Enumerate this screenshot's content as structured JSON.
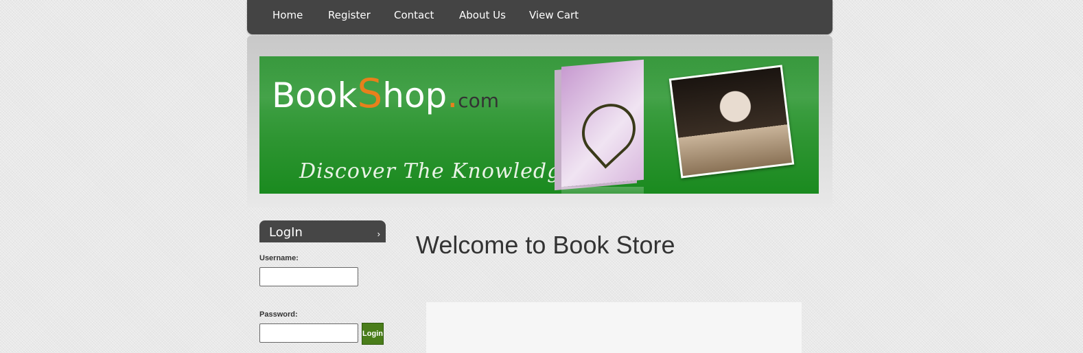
{
  "nav": {
    "items": [
      {
        "label": "Home"
      },
      {
        "label": "Register"
      },
      {
        "label": "Contact"
      },
      {
        "label": "About Us"
      },
      {
        "label": "View Cart"
      }
    ]
  },
  "banner": {
    "logo_part1": "Book",
    "logo_s": "S",
    "logo_part2": "hop",
    "logo_dot": ".",
    "logo_tld": "com",
    "tagline": "Discover The Knowledge"
  },
  "login": {
    "title": "LogIn",
    "chevron": "›",
    "username_label": "Username:",
    "username_value": "",
    "password_label": "Password:",
    "password_value": "",
    "button_label": "Login"
  },
  "main": {
    "heading": "Welcome to Book Store"
  },
  "colors": {
    "nav_bg": "#444444",
    "banner_green": "#2e9532",
    "logo_accent": "#e8801c",
    "login_button": "#4a7d1a"
  }
}
